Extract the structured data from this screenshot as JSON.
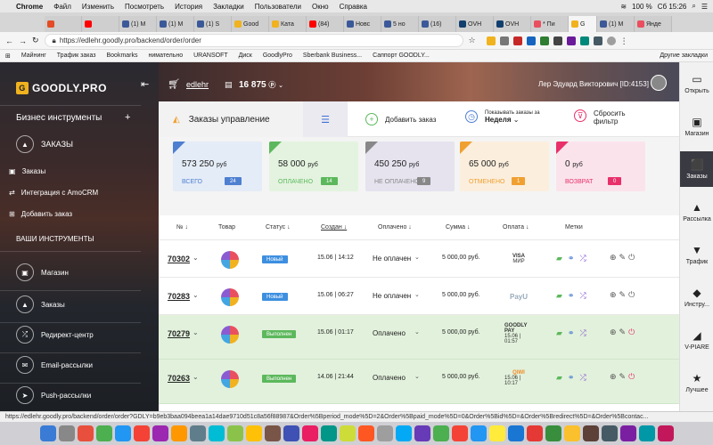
{
  "menubar": {
    "apple": "",
    "items": [
      "Chrome",
      "Файл",
      "Изменить",
      "Посмотреть",
      "История",
      "Закладки",
      "Пользователи",
      "Окно",
      "Справка"
    ],
    "battery": "100 %",
    "clock": "Сб 15:26"
  },
  "tabs": [
    {
      "label": "",
      "color": "#e34c26"
    },
    {
      "label": "",
      "color": "#ff0000"
    },
    {
      "label": "(1) M",
      "color": "#3b5998"
    },
    {
      "label": "(1) M",
      "color": "#3b5998"
    },
    {
      "label": "(1) S",
      "color": "#3b5998"
    },
    {
      "label": "Good",
      "color": "#f0b21f"
    },
    {
      "label": "Ката",
      "color": "#f0b21f"
    },
    {
      "label": "(84)",
      "color": "#ff0000"
    },
    {
      "label": "Новс",
      "color": "#3b5998"
    },
    {
      "label": "5 но",
      "color": "#3b5998"
    },
    {
      "label": "(16)",
      "color": "#3b5998"
    },
    {
      "label": "OVH",
      "color": "#123f6d"
    },
    {
      "label": "OVH",
      "color": "#123f6d"
    },
    {
      "label": "* Пи",
      "color": "#e94f5f"
    },
    {
      "label": "G",
      "color": "#f0b21f",
      "active": true
    },
    {
      "label": "(1) M",
      "color": "#3b5998"
    },
    {
      "label": "Янде",
      "color": "#e94f5f"
    }
  ],
  "address": {
    "url": "https://edlehr.goodly.pro/backend/order/order"
  },
  "bookmarks": [
    "Майнинг",
    "Трафик заказ",
    "Bookmarks",
    "нимательно",
    "URANSOFT",
    "Диск",
    "GoodlyPro",
    "Sberbank Business...",
    "Саппорт GOODLY...",
    "Другие закладки"
  ],
  "sidebar": {
    "logo": "GOODLY.PRO",
    "logo_letter": "G",
    "business_tools": "Бизнес инструменты",
    "plus": "+",
    "section": "ЗАКАЗЫ",
    "sub_items": [
      "Заказы",
      "Интеграция с AmoCRM",
      "Добавить заказ"
    ],
    "your_tools": "ВАШИ ИНСТРУМЕНТЫ",
    "tools": [
      "Магазин",
      "Заказы",
      "Редирект-центр",
      "Email-рассылки",
      "Push-рассылки"
    ]
  },
  "header": {
    "user_login": "edlehr",
    "balance": "16 875",
    "user_name": "Лер Эдуард Викторович [ID:4153]"
  },
  "toolbar": {
    "title": "Заказы управление",
    "add_order": "Добавить заказ",
    "show_label": "Показывать заказы за",
    "show_value": "Неделя",
    "reset_1": "Сбросить",
    "reset_2": "фильтр"
  },
  "cards": [
    {
      "amount": "573 250",
      "currency": "руб",
      "label": "ВСЕГО",
      "count": "24",
      "color": "#4e7fd1",
      "bg": "#e4ecf7"
    },
    {
      "amount": "58 000",
      "currency": "руб",
      "label": "ОПЛАЧЕНО",
      "count": "14",
      "color": "#5cb85c",
      "bg": "#e3f3df"
    },
    {
      "amount": "450 250",
      "currency": "руб",
      "label": "НЕ ОПЛАЧЕНО",
      "count": "9",
      "color": "#888888",
      "bg": "#e6e3ef"
    },
    {
      "amount": "65 000",
      "currency": "руб",
      "label": "ОТМЕНЕНО",
      "count": "1",
      "color": "#f0a030",
      "bg": "#fbeedd"
    },
    {
      "amount": "0",
      "currency": "руб",
      "label": "ВОЗВРАТ",
      "count": "0",
      "color": "#e8306a",
      "bg": "#fbe3ec"
    }
  ],
  "table": {
    "headers": {
      "num": "№ ↓",
      "product": "Товар",
      "status": "Статус ↓",
      "created": "Создан ↓",
      "paid": "Оплачено ↓",
      "sum": "Сумма ↓",
      "payment": "Оплата ↓",
      "tags": "Метки"
    },
    "rows": [
      {
        "num": "70302",
        "status": "Новый",
        "date": "15.06 | 14:12",
        "paid": "Не оплачен",
        "sum": "5 000,00 руб.",
        "pay": "VISA",
        "pay2": "МИР",
        "done": false
      },
      {
        "num": "70283",
        "status": "Новый",
        "date": "15.06 | 06:27",
        "paid": "Не оплачен",
        "sum": "5 000,00 руб.",
        "pay": "PayU",
        "pay2": "",
        "done": false
      },
      {
        "num": "70279",
        "status": "Выполнен",
        "date": "15.06 | 01:17",
        "paid": "Оплачено",
        "sum": "5 000,00 руб.",
        "pay": "GOODLY PAY",
        "pay2": "15.06 | 01:57",
        "done": true
      },
      {
        "num": "70263",
        "status": "Выполнен",
        "date": "14.06 | 21:44",
        "paid": "Оплачено",
        "sum": "5 000,00 руб.",
        "pay": "QIWI",
        "pay2": "15.06 | 10:17",
        "done": true
      }
    ]
  },
  "status_url": "https://edlehr.goodly.pro/backend/order/order?GDLY=b9eb3baa094beea1a14dae9710d51c8a56f88987&Order%5Bperiod_mode%5D=2&Order%5Bpaid_mode%5D=0&Order%5Bid%5D=&Order%5Bredirect%5D=&Order%5Bcontac...",
  "rightbar": [
    {
      "label": "Открыть",
      "icon": "▭"
    },
    {
      "label": "Магазин",
      "icon": "▣"
    },
    {
      "label": "Заказы",
      "icon": "⬛",
      "active": true
    },
    {
      "label": "Рассылка",
      "icon": "▲"
    },
    {
      "label": "Трафик",
      "icon": "▼"
    },
    {
      "label": "Инстру...",
      "icon": "◆"
    },
    {
      "label": "V-PIARE",
      "icon": "◢"
    },
    {
      "label": "Лучшее",
      "icon": "★"
    }
  ],
  "dock_colors": [
    "#3a7bd5",
    "#888",
    "#e84f3c",
    "#4caf50",
    "#2196f3",
    "#f44336",
    "#9c27b0",
    "#ff9800",
    "#607d8b",
    "#00bcd4",
    "#8bc34a",
    "#ffc107",
    "#795548",
    "#3f51b5",
    "#e91e63",
    "#009688",
    "#cddc39",
    "#ff5722",
    "#9e9e9e",
    "#03a9f4",
    "#673ab7",
    "#4caf50",
    "#f44336",
    "#2196f3",
    "#ffeb3b",
    "#1976d2",
    "#e53935",
    "#388e3c",
    "#fbc02d",
    "#5d4037",
    "#455a64",
    "#7b1fa2",
    "#0097a7",
    "#c2185b"
  ]
}
